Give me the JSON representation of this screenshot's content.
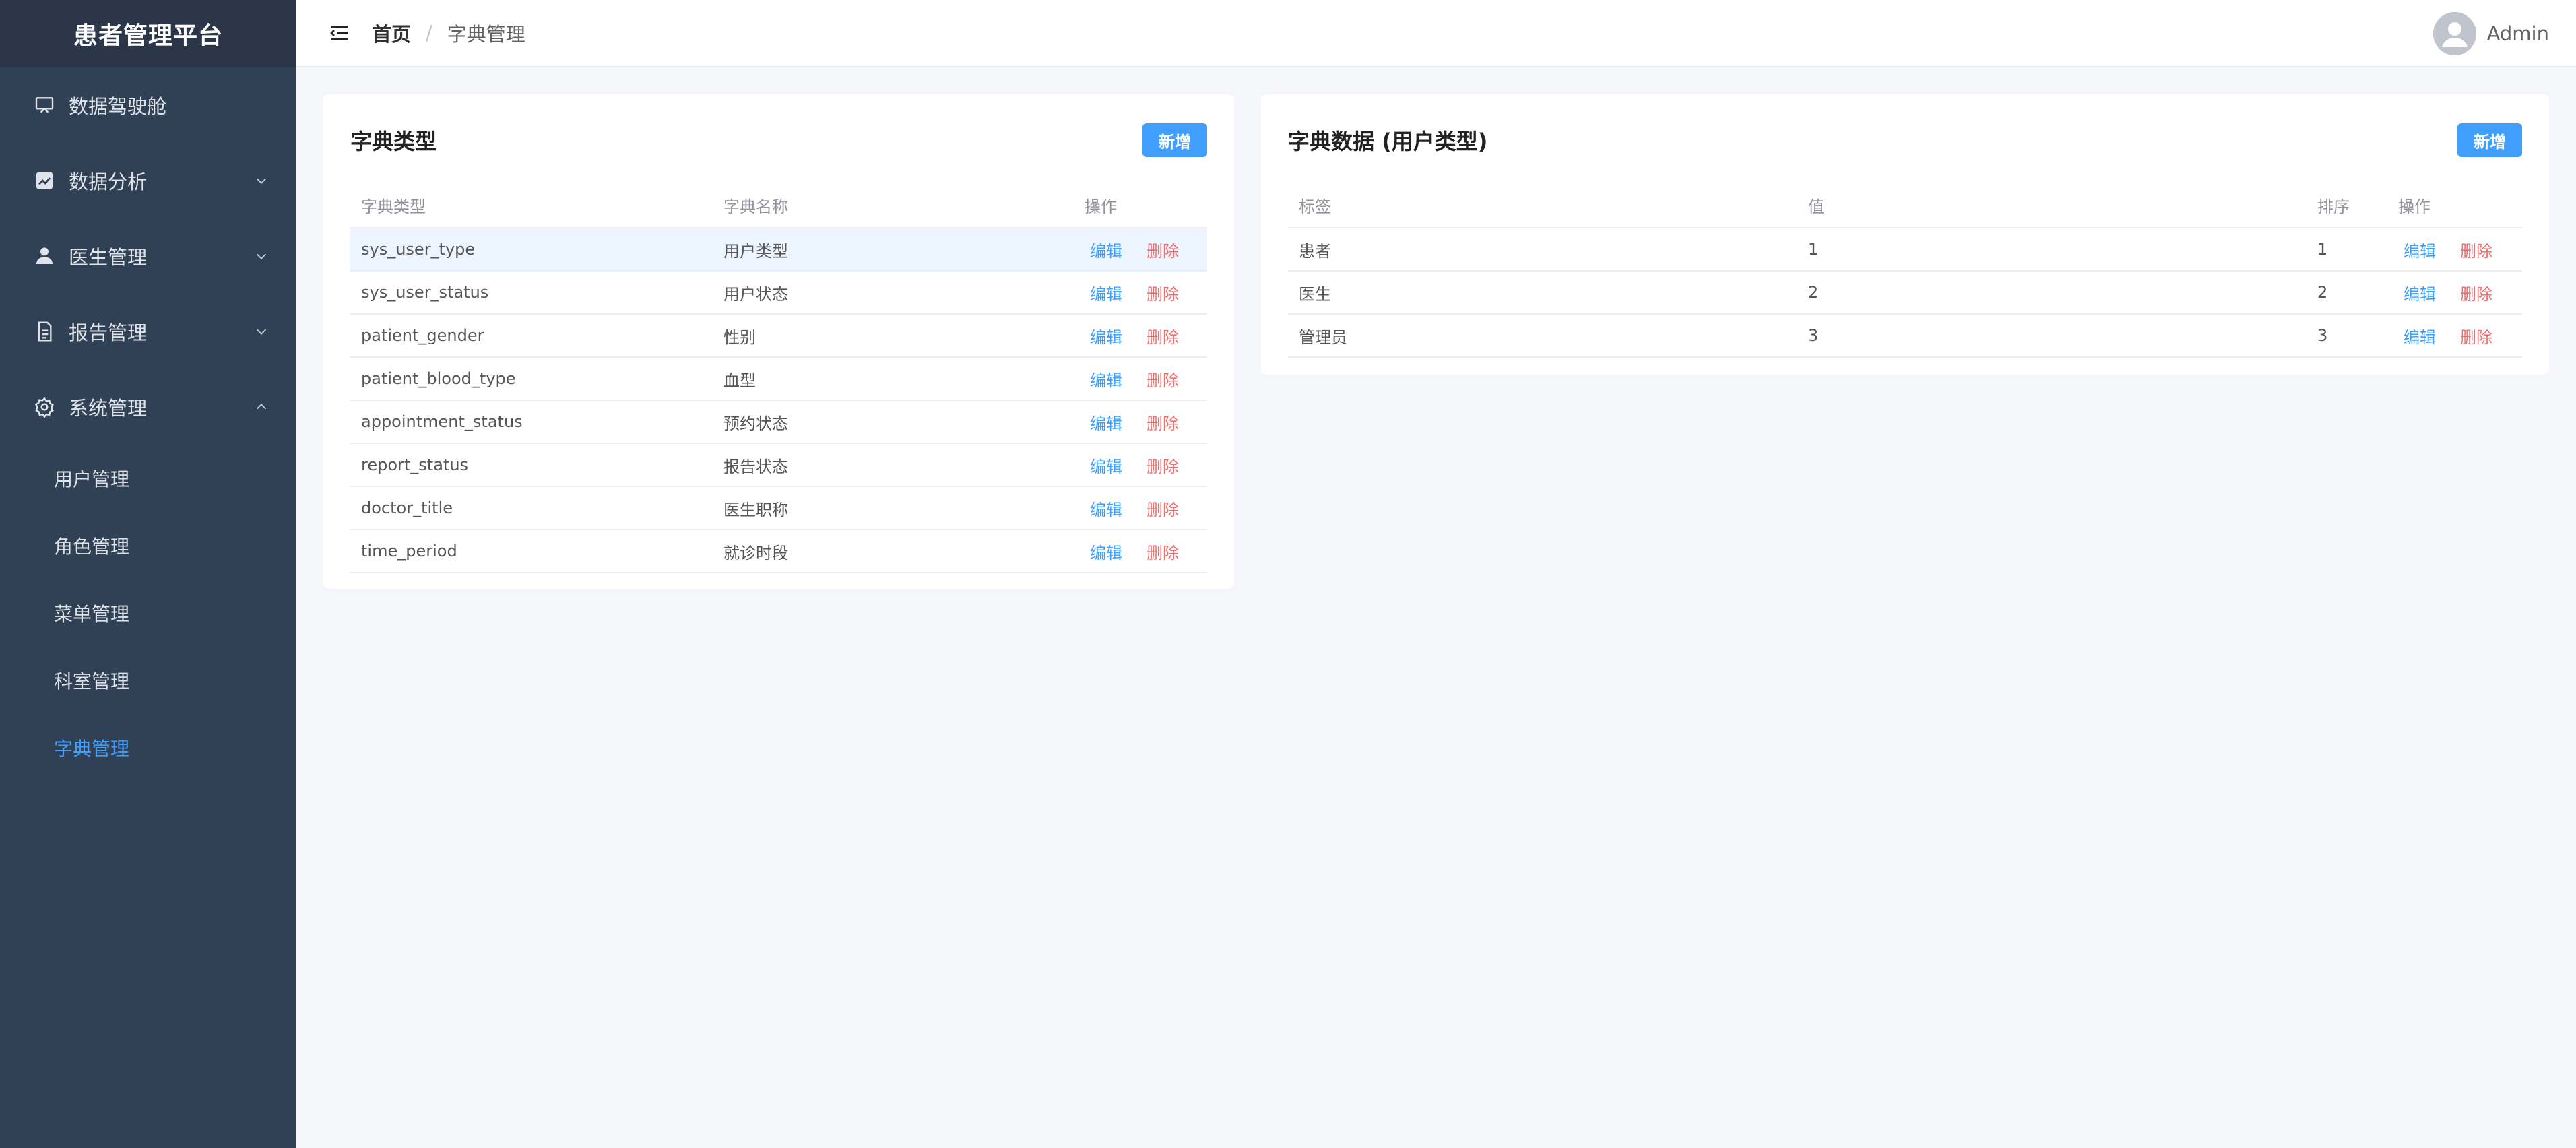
{
  "sidebar": {
    "logo": "患者管理平台",
    "items": [
      {
        "label": "数据驾驶舱",
        "icon": "presentation-board-icon"
      },
      {
        "label": "数据分析",
        "icon": "line-chart-icon"
      },
      {
        "label": "医生管理",
        "icon": "user-icon"
      },
      {
        "label": "报告管理",
        "icon": "document-icon"
      },
      {
        "label": "系统管理",
        "icon": "gear-icon"
      }
    ],
    "system_sub": [
      {
        "label": "用户管理"
      },
      {
        "label": "角色管理"
      },
      {
        "label": "菜单管理"
      },
      {
        "label": "科室管理"
      },
      {
        "label": "字典管理"
      }
    ]
  },
  "header": {
    "breadcrumb_home": "首页",
    "breadcrumb_sep": "/",
    "breadcrumb_current": "字典管理",
    "username": "Admin"
  },
  "dict_types": {
    "title": "字典类型",
    "add_label": "新增",
    "columns": [
      "字典类型",
      "字典名称",
      "操作"
    ],
    "rows": [
      {
        "type": "sys_user_type",
        "name": "用户类型"
      },
      {
        "type": "sys_user_status",
        "name": "用户状态"
      },
      {
        "type": "patient_gender",
        "name": "性别"
      },
      {
        "type": "patient_blood_type",
        "name": "血型"
      },
      {
        "type": "appointment_status",
        "name": "预约状态"
      },
      {
        "type": "report_status",
        "name": "报告状态"
      },
      {
        "type": "doctor_title",
        "name": "医生职称"
      },
      {
        "type": "time_period",
        "name": "就诊时段"
      }
    ],
    "edit_label": "编辑",
    "delete_label": "删除"
  },
  "dict_data": {
    "title": "字典数据 (用户类型)",
    "add_label": "新增",
    "columns": [
      "标签",
      "值",
      "排序",
      "操作"
    ],
    "rows": [
      {
        "label": "患者",
        "value": "1",
        "sort": "1"
      },
      {
        "label": "医生",
        "value": "2",
        "sort": "2"
      },
      {
        "label": "管理员",
        "value": "3",
        "sort": "3"
      }
    ],
    "edit_label": "编辑",
    "delete_label": "删除"
  },
  "colors": {
    "sidebar_bg": "#304156",
    "logo_bg": "#2b3649",
    "accent": "#409eff",
    "danger": "#f56c6c"
  }
}
